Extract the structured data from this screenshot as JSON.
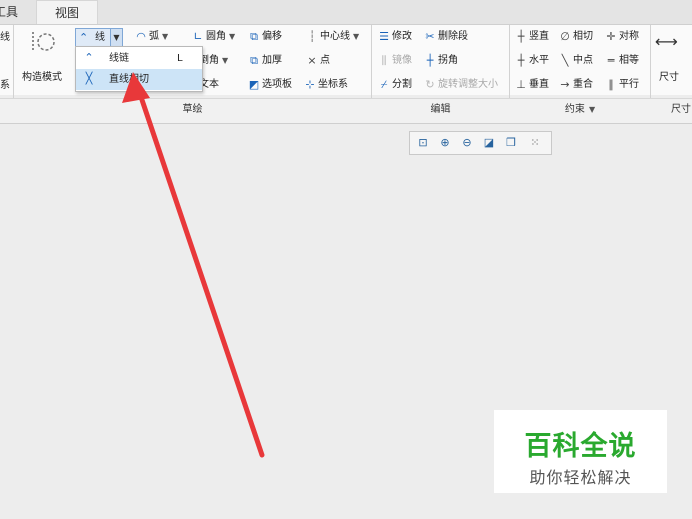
{
  "tabs": {
    "tools": "工具",
    "view": "视图"
  },
  "ribbon": {
    "construct_mode": "构造模式",
    "left_edge_top": "线",
    "left_edge_bottom": "系",
    "line": "线",
    "arc": "弧",
    "fillet": "圆角",
    "chamfer": "倒角",
    "text": "文本",
    "offset": "偏移",
    "thicken": "加厚",
    "palette": "选项板",
    "centerline": "中心线",
    "point": "点",
    "coord_sys": "坐标系",
    "modify": "修改",
    "delete_segment": "删除段",
    "mirror": "镜像",
    "corner": "拐角",
    "divide": "分割",
    "rotate_resize": "旋转调整大小",
    "vertical": "竖直",
    "tangent": "相切",
    "symmetric": "对称",
    "horizontal": "水平",
    "midpoint": "中点",
    "equal": "相等",
    "perpendicular": "垂直",
    "coincident": "重合",
    "parallel": "平行",
    "dimension": "尺寸"
  },
  "groups": {
    "sketch": "草绘",
    "edit": "编辑",
    "constraint": "约束",
    "dimension_partial": "尺寸"
  },
  "dropdown": {
    "items": [
      {
        "label": "线链",
        "shortcut": "L"
      },
      {
        "label": "直线相切",
        "shortcut": ""
      }
    ]
  },
  "colors": {
    "arrow": "#e8383a",
    "watermark_green": "#2aa92f",
    "highlight": "#cde4f7"
  },
  "watermark": {
    "title": "百科全说",
    "subtitle": "助你轻松解决"
  }
}
